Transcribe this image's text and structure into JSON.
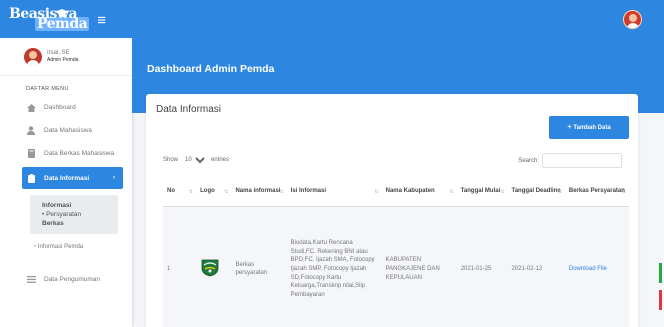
{
  "brand": {
    "line1": "Beasiswa",
    "line2": "Pemda"
  },
  "user": {
    "name": "Irsal, SE",
    "role": "Admin Pemda"
  },
  "sidebar": {
    "menu_header": "DAFTAR MENU",
    "items": [
      {
        "label": "Dashboard",
        "icon": "home-icon"
      },
      {
        "label": "Data Mahasiswa",
        "icon": "user-icon"
      },
      {
        "label": "Data Berkas Mahasiswa",
        "icon": "book-icon"
      },
      {
        "label": "Data Informasi",
        "icon": "clipboard-icon",
        "caret": "‹"
      },
      {
        "label": "Data Pengumuman",
        "icon": "list-icon"
      }
    ],
    "submenu": {
      "active_title": "Informasi",
      "active_line1": "Persyaratan",
      "active_line2": "Berkas",
      "item": "Informasi Pemda"
    }
  },
  "page_title": "Dashboard Admin Pemda",
  "card": {
    "title": "Data Informasi",
    "add_button": "Tambah Data",
    "show_label": "Show",
    "show_value": "10",
    "entries_label": "entries",
    "search_label": "Search:"
  },
  "table": {
    "columns": [
      "No",
      "Logo",
      "Nama informasi",
      "Isi Informasi",
      "Nama Kabupaten",
      "Tanggal Mulai",
      "Tanggal Deadline",
      "Berkas Persyaratan"
    ],
    "rows": [
      {
        "no": "1",
        "nama": "Berkas persyaratan",
        "isi": "Biodata,Kartu Rencana Studi,FC. Rekening BNI atau BPD,FC. Ijazah SMA, Fotocopy Ijazah SMP, Fotocopy Ijazah SD,Fotocopy Kartu Keluarga,Transkrip nilai,Slip Pembayaran",
        "kabupaten": "KABUPATEN PANGKAJENE DAN KEPULAUAN",
        "mulai": "2021-01-25",
        "deadline": "2021-02-12",
        "berkas": "Download File"
      }
    ]
  },
  "colors": {
    "primary": "#2d86e0",
    "background": "#f4f6f9"
  }
}
